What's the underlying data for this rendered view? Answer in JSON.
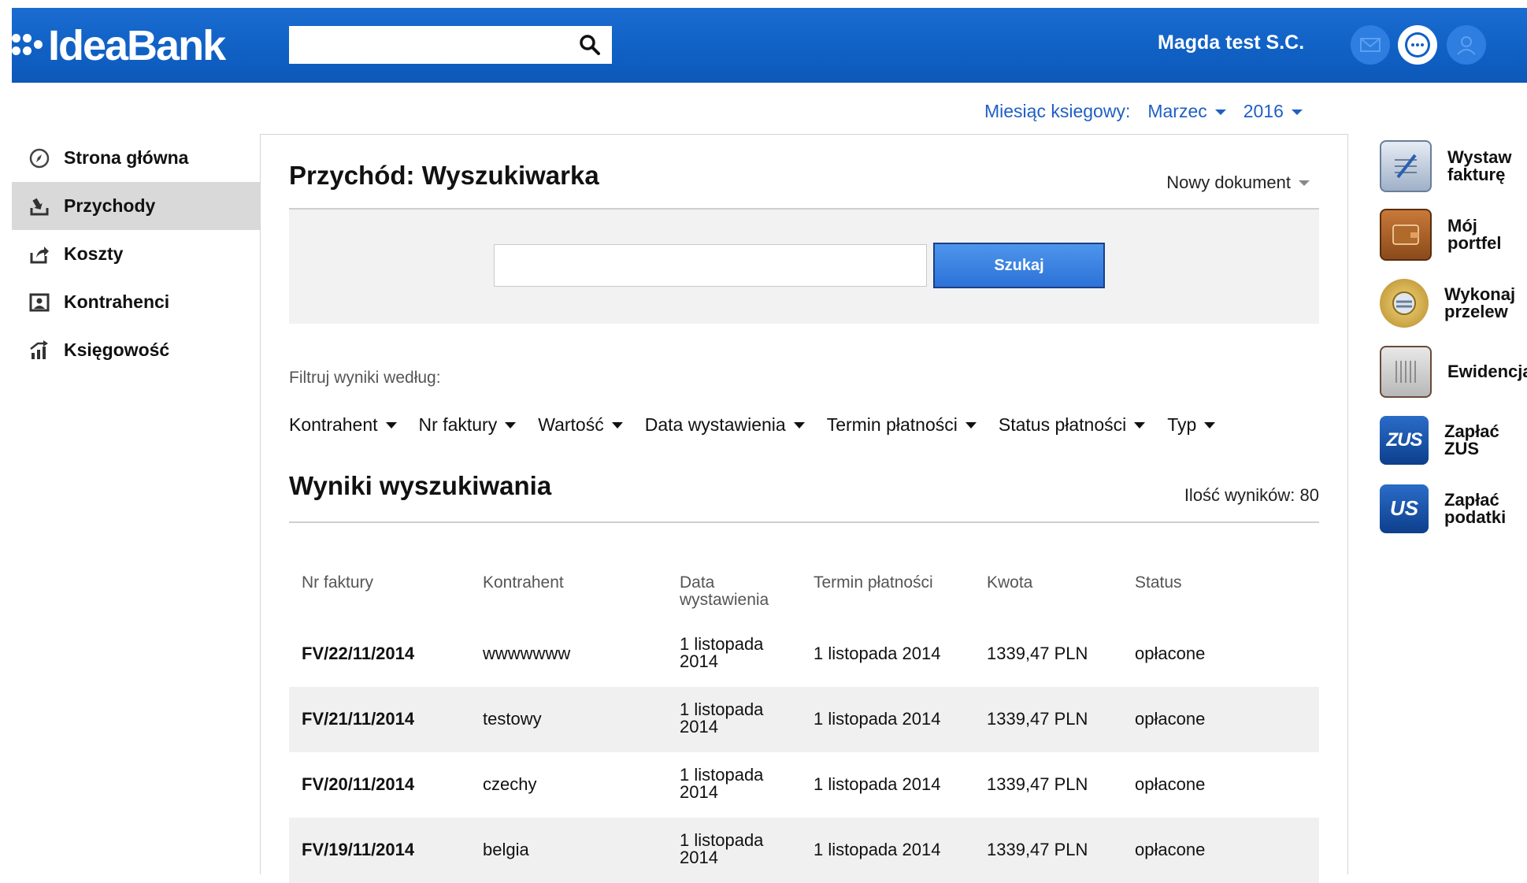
{
  "header": {
    "logo_text": "IdeaBank",
    "search_placeholder": "",
    "company_name": "Magda test S.C."
  },
  "month_selector": {
    "label": "Miesiąc ksiegowy:",
    "month": "Marzec",
    "year": "2016"
  },
  "sidebar": {
    "items": [
      {
        "label": "Strona główna",
        "icon": "compass-icon"
      },
      {
        "label": "Przychody",
        "icon": "income-icon",
        "active": true
      },
      {
        "label": "Koszty",
        "icon": "costs-icon"
      },
      {
        "label": "Kontrahenci",
        "icon": "contacts-icon"
      },
      {
        "label": "Księgowość",
        "icon": "accounting-icon"
      }
    ]
  },
  "main": {
    "title": "Przychód: Wyszukiwarka",
    "new_document": "Nowy dokument",
    "search_input_value": "",
    "search_button": "Szukaj",
    "filter_label": "Filtruj wyniki według:",
    "filters": [
      "Kontrahent",
      "Nr faktury",
      "Wartość",
      "Data wystawienia",
      "Termin płatności",
      "Status płatności",
      "Typ"
    ],
    "results_title": "Wyniki wyszukiwania",
    "results_count": "Ilość wyników: 80",
    "table": {
      "headers": [
        "Nr faktury",
        "Kontrahent",
        "Data wystawienia",
        "Termin płatności",
        "Kwota",
        "Status"
      ],
      "rows": [
        [
          "FV/22/11/2014",
          "wwwwwww",
          "1 listopada 2014",
          "1 listopada 2014",
          "1339,47 PLN",
          "opłacone"
        ],
        [
          "FV/21/11/2014",
          "testowy",
          "1 listopada 2014",
          "1 listopada 2014",
          "1339,47 PLN",
          "opłacone"
        ],
        [
          "FV/20/11/2014",
          "czechy",
          "1 listopada 2014",
          "1 listopada 2014",
          "1339,47 PLN",
          "opłacone"
        ],
        [
          "FV/19/11/2014",
          "belgia",
          "1 listopada 2014",
          "1 listopada 2014",
          "1339,47 PLN",
          "opłacone"
        ]
      ]
    }
  },
  "quick_actions": [
    {
      "label": "Wystaw fakturę",
      "icon": "invoice-icon"
    },
    {
      "label": "Mój portfel",
      "icon": "wallet-icon"
    },
    {
      "label": "Wykonaj przelew",
      "icon": "transfer-icon"
    },
    {
      "label": "Ewidencja",
      "icon": "register-icon"
    },
    {
      "label": "Zapłać ZUS",
      "icon": "zus-icon",
      "icon_text": "ZUS"
    },
    {
      "label": "Zapłać podatki",
      "icon": "us-icon",
      "icon_text": "US"
    }
  ],
  "colors": {
    "header_blue": "#1060c4",
    "link_blue": "#1f5fc4",
    "button_blue": "#2c72d8"
  }
}
